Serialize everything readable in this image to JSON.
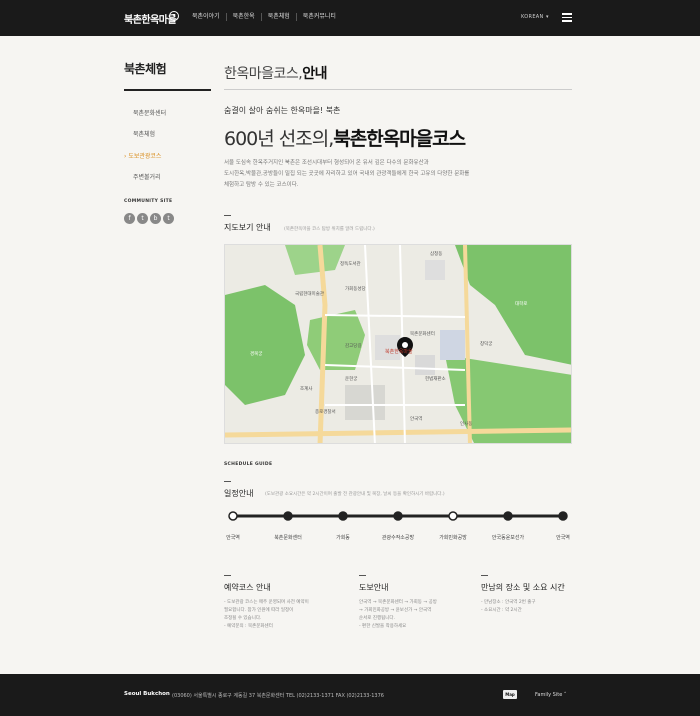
{
  "header": {
    "logo": "북촌한옥마을",
    "nav": [
      "북촌이야기",
      "북촌한옥",
      "북촌체험",
      "북촌커뮤니티"
    ],
    "language": "KOREAN"
  },
  "sidebar": {
    "title": "북촌체험",
    "items": [
      "북촌문화센터",
      "북촌체험",
      "도보관광코스",
      "주변볼거리"
    ],
    "active_index": 2,
    "community_label": "COMMUNITY SITE",
    "sns": [
      "f",
      "t",
      "b",
      "t"
    ]
  },
  "main": {
    "page_title_light": "한옥마을코스,",
    "page_title_bold": "안내",
    "lead": "숨결이 살아 숨쉬는 한옥마을! 북촌",
    "headline_light": "600년 선조의,",
    "headline_bold": "북촌한옥마을코스",
    "desc_1": "서울 도심속 한옥주거지인 북촌은 조선시대부터 형성되어 온 유서 깊은 다수의 문화유산과",
    "desc_2": "도시한옥,박물관,공방들이 밀집 되는 곳곳에 자리하고 있어 국내외 관광객들에게 한국 고유의 다양한 문화를",
    "desc_3": "체험하고 탐방 수 있는 코스이다.",
    "map_title": "지도보기 안내",
    "map_note": "(북촌한옥마을 코스 탐방 위치를 알려 드립니다.)",
    "schedule_guide": "SCHEDULE GUIDE",
    "schedule_title": "일정안내",
    "schedule_note": "(도보관광 소요시간은 약 2시간이며 출발 전 관광안내 및 복장, 날씨 등을 확인하시기 바랍니다.)",
    "stops": [
      "안국역",
      "북촌문화센터",
      "가회동",
      "관광수작소공방",
      "가회민화공방",
      "안국동윤보선가",
      "안국역"
    ],
    "info": [
      {
        "title": "예약코스 안내",
        "lines": [
          "- 도보관광 코스는 매주 운영되며 사전 예약이",
          "필요합니다. 참가 인원에 따라 일정이",
          "조정될 수 있습니다.",
          "- 예약문의 : 북촌문화센터"
        ]
      },
      {
        "title": "도보안내",
        "lines": [
          "안국역 → 북촌문화센터 → 가회동 → 공방",
          "→ 가회민화공방 → 윤보선가 → 안국역",
          "순서로 진행됩니다.",
          "- 편한 신발을 착용하세요"
        ]
      },
      {
        "title": "만남의 장소 및 소요 시간",
        "lines": [
          "- 만남장소 : 안국역 2번 출구",
          "- 소요시간 : 약 2시간"
        ]
      }
    ]
  },
  "map_labels": [
    "북촌한옥마을",
    "정독도서관",
    "가회동성당",
    "국립현대미술관",
    "헌법재판소",
    "안국역",
    "창덕궁",
    "경복궁",
    "삼청동",
    "운현궁",
    "조계사",
    "인사동",
    "종로경찰서",
    "북촌문화센터",
    "감고당길",
    "대학로"
  ],
  "footer": {
    "brand": "Seoul Bukchon",
    "info": "(03060) 서울특별시 종로구 계동길 37 북촌문화센터  TEL (02)2133-1371  FAX (02)2133-1376",
    "badge": "Map",
    "family": "Family Site"
  },
  "colors": {
    "accent": "#d98c1b",
    "header_bg": "#1a1a1a",
    "route": "#222222",
    "park": "#6fbf5a",
    "road": "#f5d99a"
  }
}
